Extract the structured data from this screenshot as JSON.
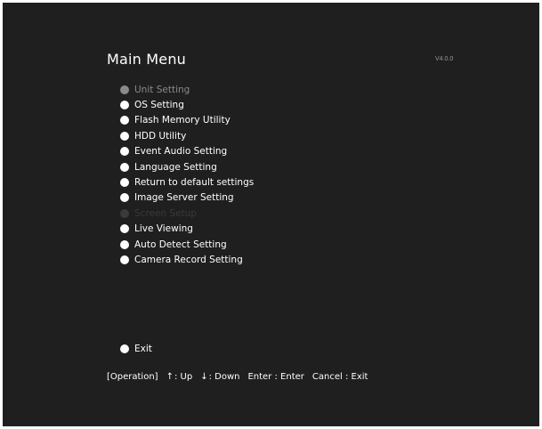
{
  "screen": {
    "title": "Main Menu",
    "version": "V4.0.0"
  },
  "menu": {
    "items": [
      {
        "label": "Unit Setting",
        "state": "selected"
      },
      {
        "label": "OS Setting",
        "state": "enabled"
      },
      {
        "label": "Flash Memory Utility",
        "state": "enabled"
      },
      {
        "label": "HDD Utility",
        "state": "enabled"
      },
      {
        "label": "Event Audio Setting",
        "state": "enabled"
      },
      {
        "label": "Language Setting",
        "state": "enabled"
      },
      {
        "label": "Return to default settings",
        "state": "enabled"
      },
      {
        "label": "Image Server Setting",
        "state": "enabled"
      },
      {
        "label": "Screen Setup",
        "state": "disabled"
      },
      {
        "label": "Live Viewing",
        "state": "enabled"
      },
      {
        "label": "Auto Detect Setting",
        "state": "enabled"
      },
      {
        "label": "Camera Record Setting",
        "state": "enabled"
      }
    ],
    "exit_label": "Exit"
  },
  "hints": {
    "operation": "[Operation]",
    "up_arrow": "↑",
    "up": ": Up",
    "down_arrow": "↓",
    "down": ": Down",
    "enter": "Enter : Enter",
    "cancel": "Cancel : Exit"
  },
  "colors": {
    "background": "#1f1f1f",
    "text": "#ffffff",
    "selected": "#8a8a8a",
    "disabled": "#3a3a3a"
  }
}
